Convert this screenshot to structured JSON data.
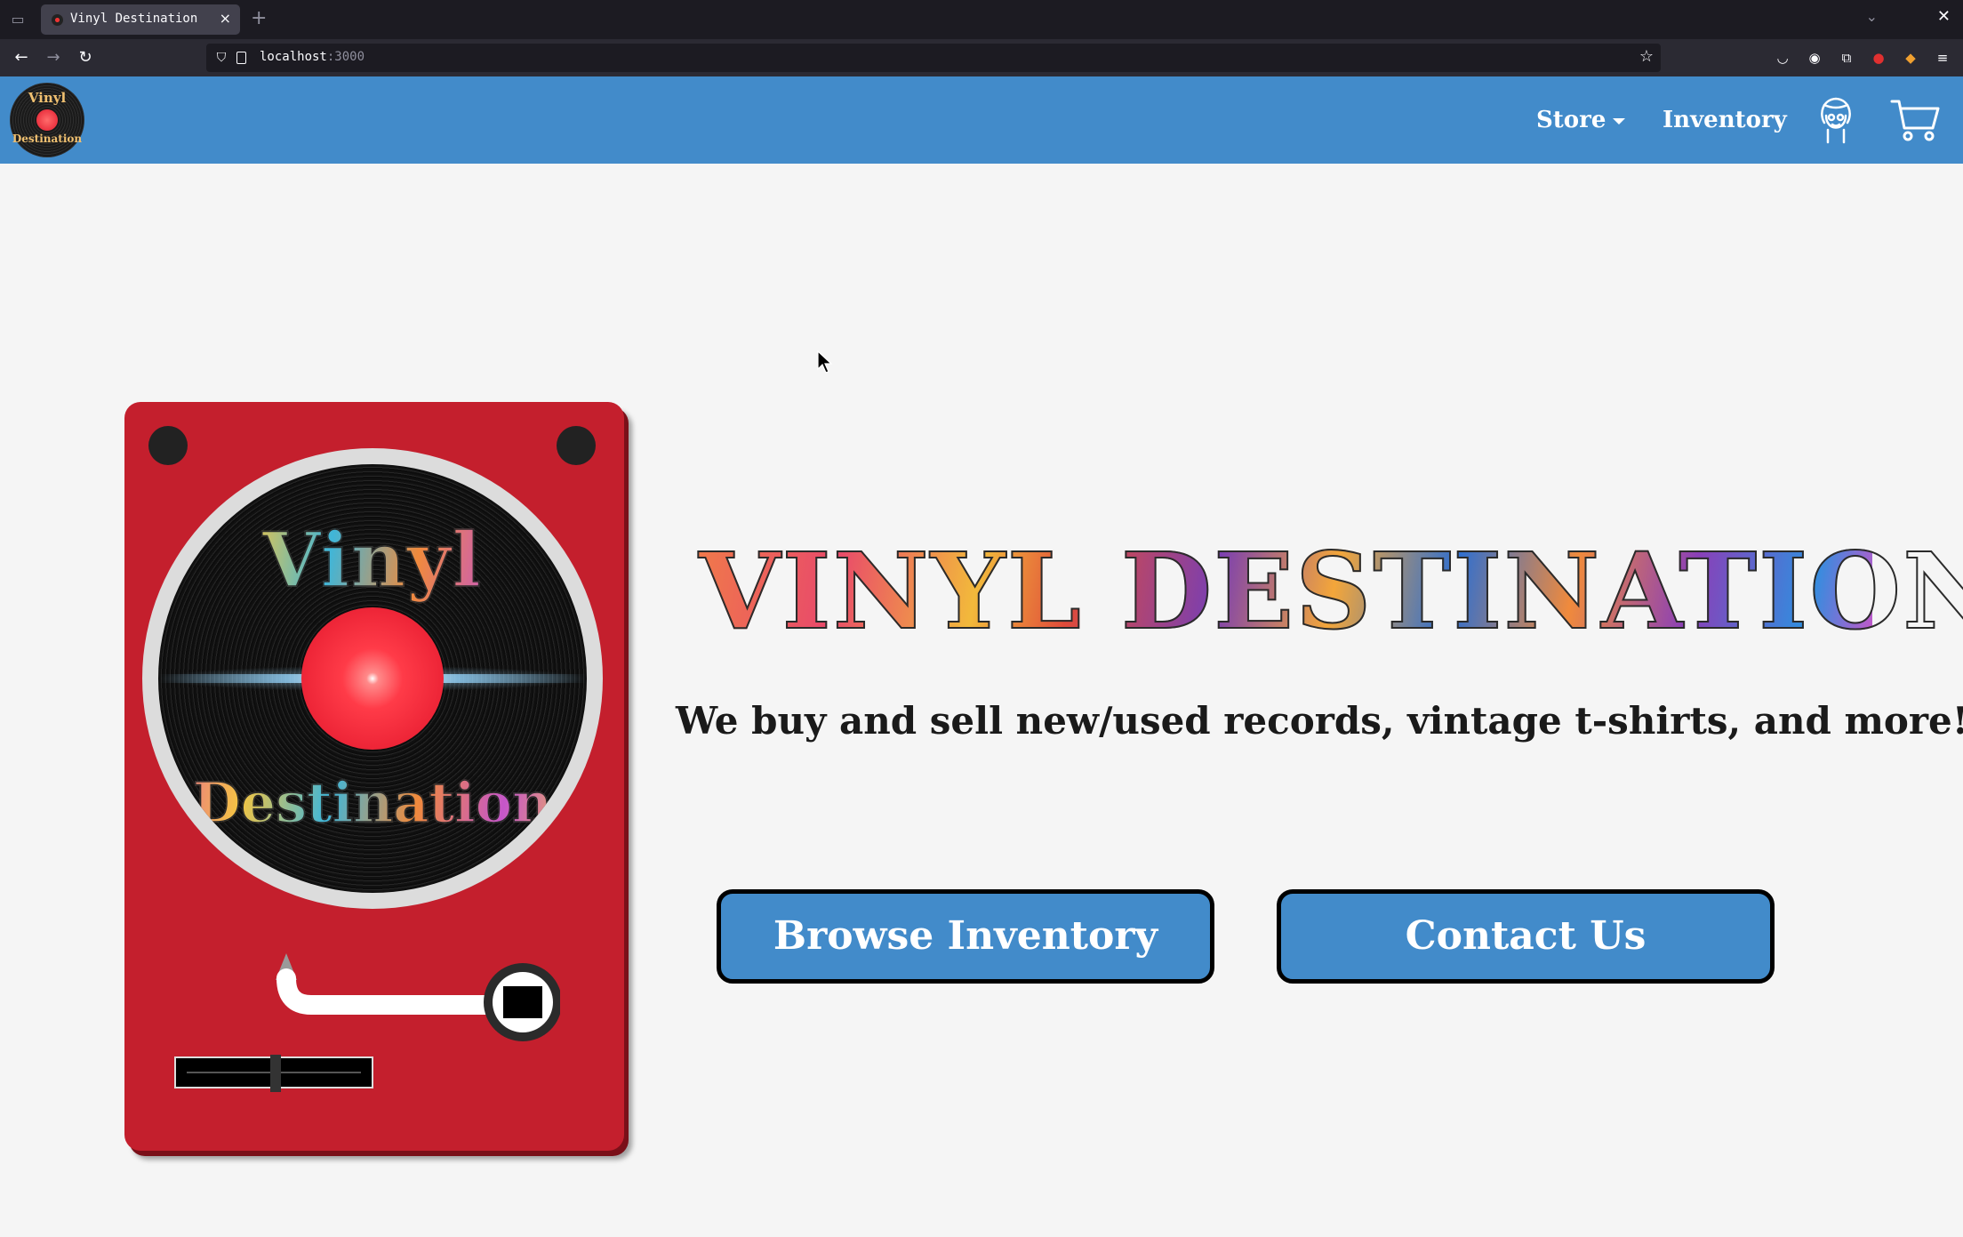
{
  "browser": {
    "tab_title": "Vinyl Destination",
    "tab_close_icon": "close-icon",
    "new_tab_icon": "plus-icon",
    "url_host": "localhost",
    "url_port": ":3000"
  },
  "header": {
    "logo_line1": "Vinyl",
    "logo_line2": "Destination",
    "store_label": "Store",
    "inventory_label": "Inventory",
    "account_icon": "user-account-icon",
    "cart_icon": "shopping-cart-icon",
    "colors": {
      "bar": "#428bca",
      "text": "#ffffff"
    }
  },
  "turntable": {
    "record_text_top": "Vinyl",
    "record_text_bottom": "Destination",
    "colors": {
      "body": "#c41f2d",
      "label": "#e0142a"
    }
  },
  "hero": {
    "title": "VINYL DESTINATION",
    "tagline": "We buy and sell new/used records, vintage t-shirts, and more!",
    "browse_button": "Browse Inventory",
    "contact_button": "Contact Us",
    "colors": {
      "button": "#428bca",
      "button_border": "#000000",
      "background": "#f5f5f5"
    }
  }
}
